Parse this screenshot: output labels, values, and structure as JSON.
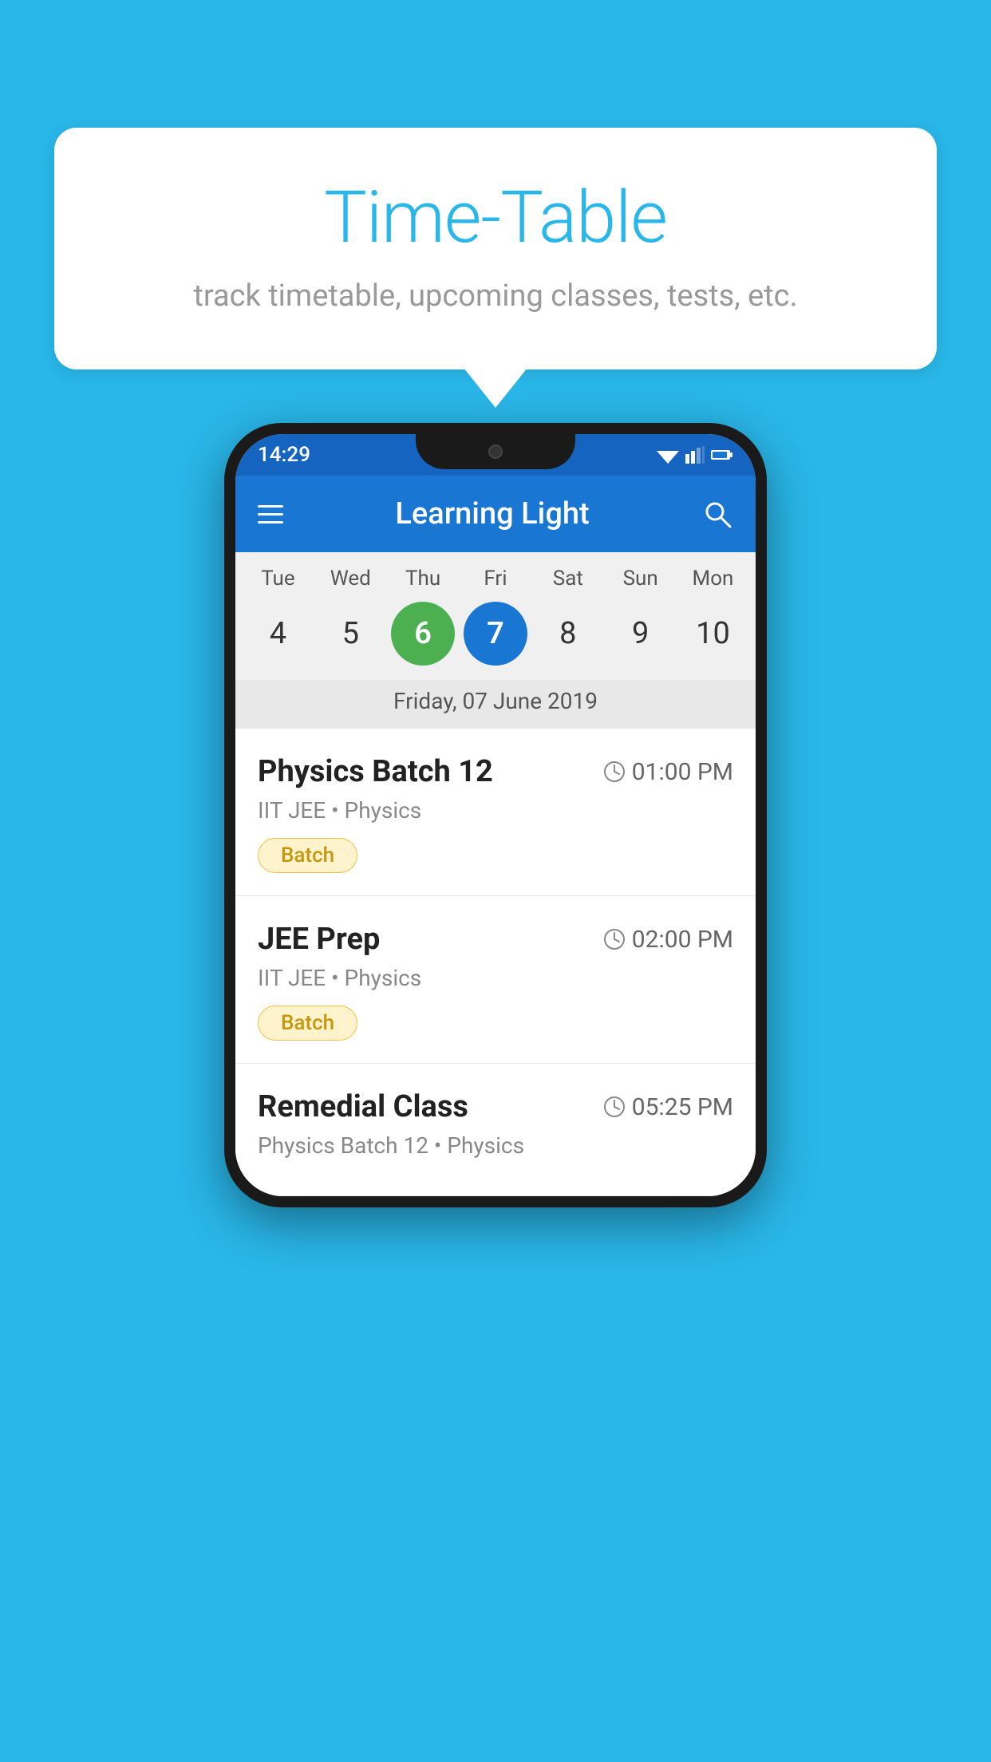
{
  "background_color": "#29b6e8",
  "speech_bubble": {
    "title": "Time-Table",
    "subtitle": "track timetable, upcoming classes, tests, etc."
  },
  "status_bar": {
    "time": "14:29"
  },
  "app_bar": {
    "title": "Learning Light",
    "menu_icon": "hamburger-menu",
    "search_icon": "search"
  },
  "calendar": {
    "days": [
      {
        "label": "Tue",
        "num": "4"
      },
      {
        "label": "Wed",
        "num": "5"
      },
      {
        "label": "Thu",
        "num": "6",
        "state": "today"
      },
      {
        "label": "Fri",
        "num": "7",
        "state": "selected"
      },
      {
        "label": "Sat",
        "num": "8"
      },
      {
        "label": "Sun",
        "num": "9"
      },
      {
        "label": "Mon",
        "num": "10"
      }
    ],
    "selected_date_label": "Friday, 07 June 2019"
  },
  "schedule": {
    "items": [
      {
        "title": "Physics Batch 12",
        "time": "01:00 PM",
        "subtitle": "IIT JEE • Physics",
        "tag": "Batch"
      },
      {
        "title": "JEE Prep",
        "time": "02:00 PM",
        "subtitle": "IIT JEE • Physics",
        "tag": "Batch"
      },
      {
        "title": "Remedial Class",
        "time": "05:25 PM",
        "subtitle": "Physics Batch 12 • Physics",
        "tag": null
      }
    ]
  }
}
